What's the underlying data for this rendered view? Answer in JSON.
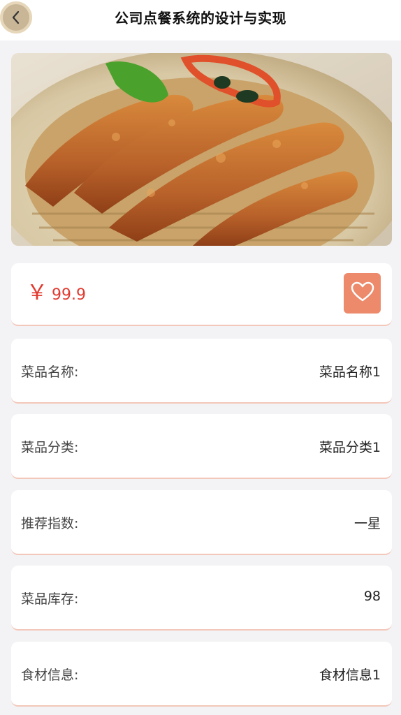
{
  "header": {
    "title": "公司点餐系统的设计与实现",
    "back_icon": "chevron-left-icon"
  },
  "hero": {
    "alt": "dish-photo-braised-chicken-feet"
  },
  "price": {
    "currency": "￥",
    "amount": "99.9",
    "favorite_icon": "heart-outline-icon",
    "accent": "#ec8a6b",
    "price_color": "#e23a2f"
  },
  "details": [
    {
      "label": "菜品名称:",
      "value": "菜品名称1"
    },
    {
      "label": "菜品分类:",
      "value": "菜品分类1"
    },
    {
      "label": "推荐指数:",
      "value": "一星"
    },
    {
      "label": "菜品库存:",
      "value": "98"
    },
    {
      "label": "食材信息:",
      "value": "食材信息1"
    }
  ]
}
